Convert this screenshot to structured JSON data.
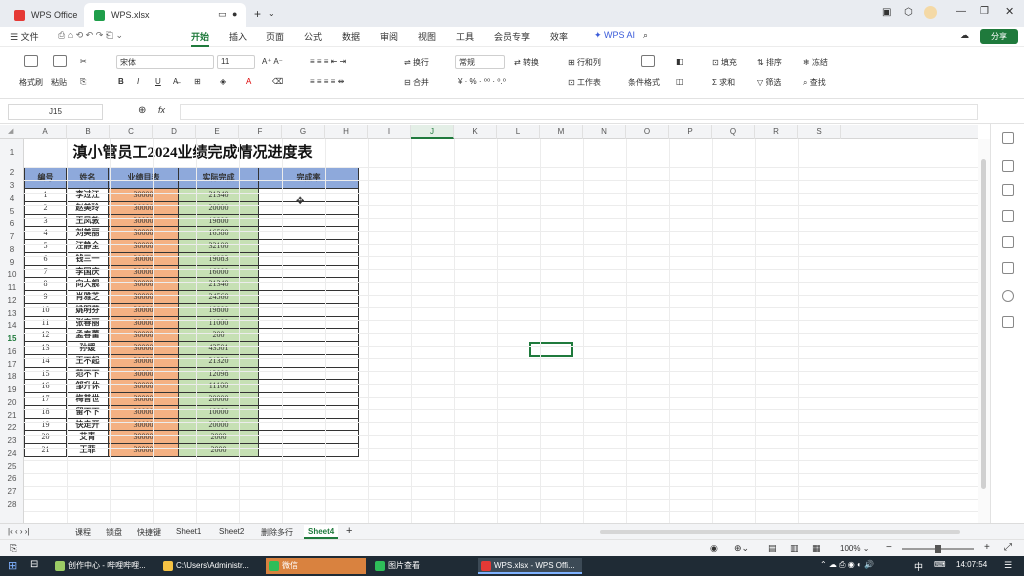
{
  "tabs": [
    {
      "label": "WPS Office",
      "color": "#e53935"
    },
    {
      "label": "WPS.xlsx",
      "color": "#1f9e4a"
    }
  ],
  "menu": {
    "file": "文件",
    "items": [
      "开始",
      "插入",
      "页面",
      "公式",
      "数据",
      "审阅",
      "视图",
      "工具",
      "会员专享",
      "效率"
    ],
    "active": "开始",
    "wps_ai": "WPS AI",
    "share": "分享"
  },
  "toolbar": {
    "format_painter": "格式刷",
    "paste": "粘贴",
    "font_name": "宋体",
    "font_size": "11",
    "wrap": "换行",
    "merge": "合并",
    "number_format": "常规",
    "convert": "转换",
    "row_col": "行和列",
    "worksheet": "工作表",
    "cond_format": "条件格式",
    "fill": "填充",
    "sort": "排序",
    "freeze": "冻结",
    "sum": "求和",
    "filter": "筛选",
    "find": "查找"
  },
  "formula_bar": {
    "cell_ref": "J15",
    "fx": "fx"
  },
  "columns": [
    "A",
    "B",
    "C",
    "D",
    "E",
    "F",
    "G",
    "H",
    "I",
    "J",
    "K",
    "L",
    "M",
    "N",
    "O",
    "P",
    "Q",
    "R",
    "S"
  ],
  "selected_column": "J",
  "row_count": 28,
  "selected_row": "15",
  "sheet": {
    "title": "滇小管员工2024业绩完成情况进度表",
    "headers": [
      "编号",
      "姓名",
      "业绩目表",
      "实际完成",
      "完成率"
    ],
    "rows": [
      {
        "id": "1",
        "name": "李过江",
        "target": "30000",
        "actual": "21340"
      },
      {
        "id": "2",
        "name": "赵美玲",
        "target": "30000",
        "actual": "20000"
      },
      {
        "id": "3",
        "name": "王凤敦",
        "target": "30000",
        "actual": "19800"
      },
      {
        "id": "4",
        "name": "刘美丽",
        "target": "30000",
        "actual": "16580"
      },
      {
        "id": "5",
        "name": "汪静全",
        "target": "30000",
        "actual": "32100"
      },
      {
        "id": "6",
        "name": "钱三一",
        "target": "30000",
        "actual": "19083"
      },
      {
        "id": "7",
        "name": "李国庆",
        "target": "30000",
        "actual": "16000"
      },
      {
        "id": "8",
        "name": "向大舰",
        "target": "30000",
        "actual": "21340"
      },
      {
        "id": "9",
        "name": "肖雅芝",
        "target": "30000",
        "actual": "24560"
      },
      {
        "id": "10",
        "name": "姚明芬",
        "target": "30000",
        "actual": "19800"
      },
      {
        "id": "11",
        "name": "张春丽",
        "target": "30000",
        "actual": "11000"
      },
      {
        "id": "12",
        "name": "孟春蕾",
        "target": "30000",
        "actual": "200"
      },
      {
        "id": "13",
        "name": "孙媛",
        "target": "30000",
        "actual": "43501"
      },
      {
        "id": "14",
        "name": "王不起",
        "target": "30000",
        "actual": "21320"
      },
      {
        "id": "15",
        "name": "范不下",
        "target": "30000",
        "actual": "12098"
      },
      {
        "id": "16",
        "name": "邹升休",
        "target": "30000",
        "actual": "11100"
      },
      {
        "id": "17",
        "name": "梅普世",
        "target": "30000",
        "actual": "20000"
      },
      {
        "id": "18",
        "name": "留不下",
        "target": "30000",
        "actual": "10000"
      },
      {
        "id": "19",
        "name": "快走开",
        "target": "30000",
        "actual": "20000"
      },
      {
        "id": "20",
        "name": "艾青",
        "target": "30000",
        "actual": "2000"
      },
      {
        "id": "21",
        "name": "王菲",
        "target": "30000",
        "actual": "2000"
      }
    ]
  },
  "sheet_tabs": [
    "课程",
    "锁盘",
    "快捷键",
    "Sheet1",
    "Sheet2",
    "删除多行",
    "Sheet4"
  ],
  "active_sheet": "Sheet4",
  "zoom": "100%",
  "taskbar": {
    "items": [
      "创作中心 - 哔哩哔哩...",
      "C:\\Users\\Administr...",
      "微信",
      "图片查看",
      "WPS.xlsx - WPS Offi..."
    ],
    "ime": "中",
    "time": "14:07:54"
  },
  "colors": {
    "accent": "#1f7a3c",
    "header_fill": "#8ea9db",
    "target_fill": "#f4b183",
    "actual_fill": "#c6e0b4"
  }
}
